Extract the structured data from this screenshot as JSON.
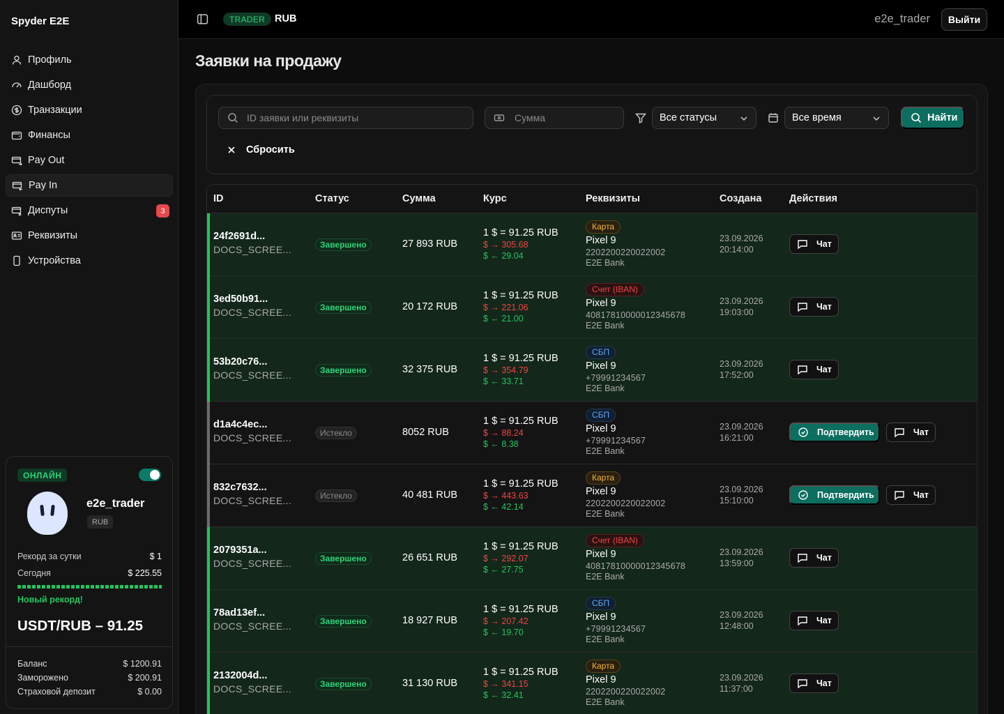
{
  "brand": "Spyder E2E",
  "nav": [
    {
      "label": "Профиль",
      "icon": "user-icon"
    },
    {
      "label": "Дашборд",
      "icon": "gauge-icon"
    },
    {
      "label": "Транзакции",
      "icon": "dollar-circle-icon"
    },
    {
      "label": "Финансы",
      "icon": "wallet-icon"
    },
    {
      "label": "Pay Out",
      "icon": "card-out-icon"
    },
    {
      "label": "Pay In",
      "icon": "card-in-icon"
    },
    {
      "label": "Диспуты",
      "icon": "dispute-icon",
      "badge": "3"
    },
    {
      "label": "Реквизиты",
      "icon": "id-card-icon"
    },
    {
      "label": "Устройства",
      "icon": "phone-icon"
    }
  ],
  "user_card": {
    "online": "ОНЛАЙН",
    "username": "e2e_trader",
    "currency": "RUB",
    "record_label": "Рекорд за сутки",
    "record_value": "$ 1",
    "today_label": "Сегодня",
    "today_value": "$ 225.55",
    "progress": 1.0,
    "new_record": "Новый рекорд!",
    "rate": "USDT/RUB – 91.25",
    "balance_label": "Баланс",
    "balance_value": "$ 1200.91",
    "frozen_label": "Заморожено",
    "frozen_value": "$ 200.91",
    "insurance_label": "Страховой депозит",
    "insurance_value": "$ 0.00"
  },
  "header": {
    "role": "TRADER",
    "currency": "RUB",
    "username": "e2e_trader",
    "logout": "Выйти"
  },
  "page_title": "Заявки на продажу",
  "filters": {
    "search_placeholder": "ID заявки или реквизиты",
    "sum_placeholder": "Сумма",
    "status": "Все статусы",
    "period": "Все время",
    "find": "Найти",
    "reset": "Сбросить"
  },
  "table": {
    "columns": [
      "ID",
      "Статус",
      "Сумма",
      "Курс",
      "Реквизиты",
      "Создана",
      "Действия"
    ],
    "rows": [
      {
        "id": "24f2691d...",
        "sub": "DOCS_SCREE...",
        "status": "Завершено",
        "state": "done",
        "sum": "27 893 RUB",
        "rate": "1 $ = 91.25 RUB",
        "up": "$ → 305.68",
        "down": "$ ← 29.04",
        "req_type": "Карта",
        "req_kind": "card",
        "device": "Pixel 9",
        "number": "2202200220022002",
        "bank": "E2E Bank",
        "date": "23.09.2026",
        "time": "20:14:00"
      },
      {
        "id": "3ed50b91...",
        "sub": "DOCS_SCREE...",
        "status": "Завершено",
        "state": "done",
        "sum": "20 172 RUB",
        "rate": "1 $ = 91.25 RUB",
        "up": "$ → 221.06",
        "down": "$ ← 21.00",
        "req_type": "Счет (IBAN)",
        "req_kind": "iban",
        "device": "Pixel 9",
        "number": "40817810000012345678",
        "bank": "E2E Bank",
        "date": "23.09.2026",
        "time": "19:03:00"
      },
      {
        "id": "53b20c76...",
        "sub": "DOCS_SCREE...",
        "status": "Завершено",
        "state": "done",
        "sum": "32 375 RUB",
        "rate": "1 $ = 91.25 RUB",
        "up": "$ → 354.79",
        "down": "$ ← 33.71",
        "req_type": "СБП",
        "req_kind": "sbp",
        "device": "Pixel 9",
        "number": "+79991234567",
        "bank": "E2E Bank",
        "date": "23.09.2026",
        "time": "17:52:00"
      },
      {
        "id": "d1a4c4ec...",
        "sub": "DOCS_SCREE...",
        "status": "Истекло",
        "state": "expired",
        "sum": "8052 RUB",
        "rate": "1 $ = 91.25 RUB",
        "up": "$ → 88.24",
        "down": "$ ← 8.38",
        "req_type": "СБП",
        "req_kind": "sbp",
        "device": "Pixel 9",
        "number": "+79991234567",
        "bank": "E2E Bank",
        "date": "23.09.2026",
        "time": "16:21:00"
      },
      {
        "id": "832c7632...",
        "sub": "DOCS_SCREE...",
        "status": "Истекло",
        "state": "expired",
        "sum": "40 481 RUB",
        "rate": "1 $ = 91.25 RUB",
        "up": "$ → 443.63",
        "down": "$ ← 42.14",
        "req_type": "Карта",
        "req_kind": "card",
        "device": "Pixel 9",
        "number": "2202200220022002",
        "bank": "E2E Bank",
        "date": "23.09.2026",
        "time": "15:10:00"
      },
      {
        "id": "2079351a...",
        "sub": "DOCS_SCREE...",
        "status": "Завершено",
        "state": "done",
        "sum": "26 651 RUB",
        "rate": "1 $ = 91.25 RUB",
        "up": "$ → 292.07",
        "down": "$ ← 27.75",
        "req_type": "Счет (IBAN)",
        "req_kind": "iban",
        "device": "Pixel 9",
        "number": "40817810000012345678",
        "bank": "E2E Bank",
        "date": "23.09.2026",
        "time": "13:59:00"
      },
      {
        "id": "78ad13ef...",
        "sub": "DOCS_SCREE...",
        "status": "Завершено",
        "state": "done",
        "sum": "18 927 RUB",
        "rate": "1 $ = 91.25 RUB",
        "up": "$ → 207.42",
        "down": "$ ← 19.70",
        "req_type": "СБП",
        "req_kind": "sbp",
        "device": "Pixel 9",
        "number": "+79991234567",
        "bank": "E2E Bank",
        "date": "23.09.2026",
        "time": "12:48:00"
      },
      {
        "id": "2132004d...",
        "sub": "DOCS_SCREE...",
        "status": "Завершено",
        "state": "done",
        "sum": "31 130 RUB",
        "rate": "1 $ = 91.25 RUB",
        "up": "$ → 341.15",
        "down": "$ ← 32.41",
        "req_type": "Карта",
        "req_kind": "card",
        "device": "Pixel 9",
        "number": "2202200220022002",
        "bank": "E2E Bank",
        "date": "23.09.2026",
        "time": "11:37:00"
      }
    ],
    "confirm_label": "Подтвердить",
    "chat_label": "Чат"
  },
  "colors": {
    "accent": "#0b6e5f",
    "success": "#22c55e",
    "danger": "#ef4444",
    "warning": "#f5b63a",
    "info": "#60a5fa"
  }
}
